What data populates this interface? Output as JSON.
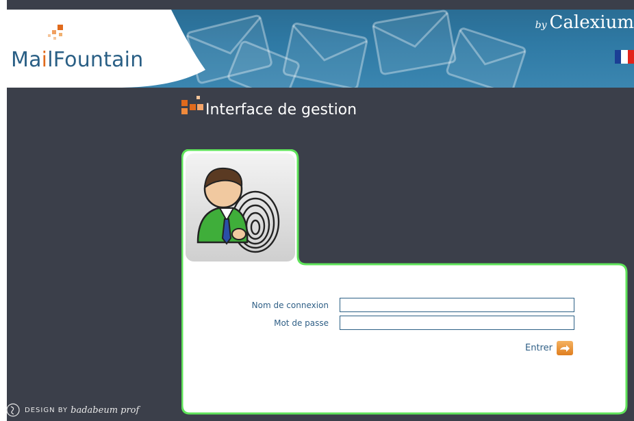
{
  "brand": {
    "logo_part1": "Ma",
    "logo_i": "i",
    "logo_part2": "lFountain",
    "by": "by",
    "company": "Calexium"
  },
  "language": {
    "flag": "french-flag",
    "colors": [
      "#1b3f95",
      "#ffffff",
      "#e2231a"
    ]
  },
  "page": {
    "title": "Interface de gestion"
  },
  "form": {
    "username_label": "Nom de connexion",
    "username_value": "",
    "password_label": "Mot de passe",
    "password_value": "",
    "submit_label": "Entrer"
  },
  "footer": {
    "design_by": "DESIGN BY",
    "designer": "badabeum prof"
  },
  "colors": {
    "accent_green": "#5fe35a",
    "accent_orange": "#e06a1c",
    "dark_bg": "#3b3f4a",
    "header_blue": "#2f7aa5",
    "text_blue": "#2f5f86"
  }
}
